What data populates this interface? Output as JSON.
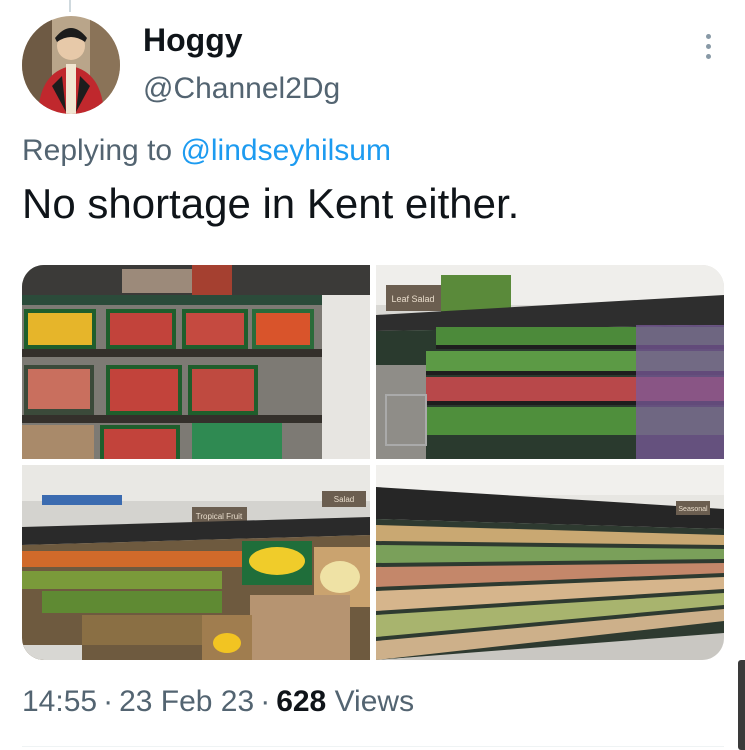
{
  "tweet": {
    "display_name": "Hoggy",
    "handle": "@Channel2Dg",
    "reply_prefix": "Replying to",
    "reply_to": "@lindseyhilsum",
    "text": "No shortage in Kent either.",
    "time": "14:55",
    "date": "23 Feb 23",
    "views_count": "628",
    "views_label": "Views"
  },
  "media": {
    "sign_leaf_salad": "Leaf Salad",
    "sign_tropical_fruit": "Tropical Fruit",
    "sign_salad": "Salad",
    "sign_seasonal": "Seasonal"
  },
  "colors": {
    "link": "#1d9bf0",
    "secondary_text": "#536471",
    "primary_text": "#0f1419"
  }
}
